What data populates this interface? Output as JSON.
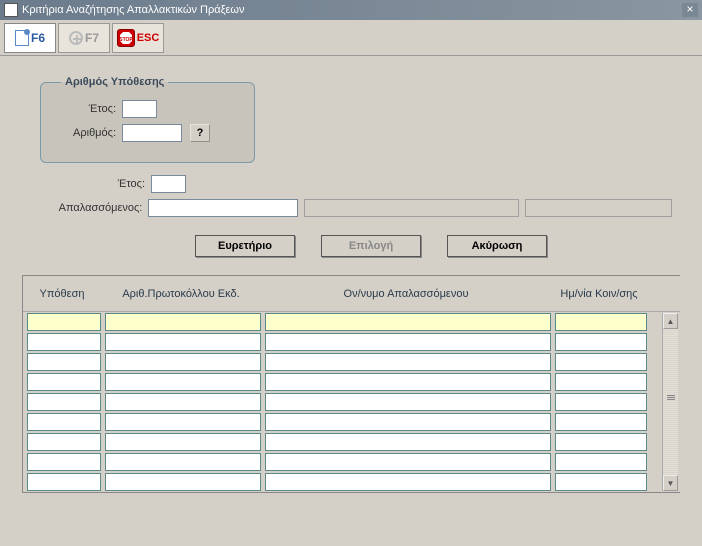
{
  "window": {
    "title": "Κριτήρια Αναζήτησης Απαλλακτικών Πράξεων"
  },
  "toolbar": {
    "f6": "F6",
    "f7": "F7",
    "esc": "ESC"
  },
  "case_group": {
    "legend": "Αριθμός Υπόθεσης",
    "year_label": "Έτος:",
    "number_label": "Αριθμός:",
    "help": "?"
  },
  "outer": {
    "year_label": "Έτος:",
    "apall_label": "Απαλασσόμενος:"
  },
  "buttons": {
    "directory": "Ευρετήριο",
    "select": "Επιλογή",
    "cancel": "Ακύρωση"
  },
  "grid": {
    "headers": {
      "case": "Υπόθεση",
      "protocol": "Αριθ.Πρωτοκόλλου Εκδ.",
      "name": "Ον/νυμο Απαλασσόμενου",
      "date": "Ημ/νία Κοιν/σης"
    },
    "row_count": 9
  }
}
